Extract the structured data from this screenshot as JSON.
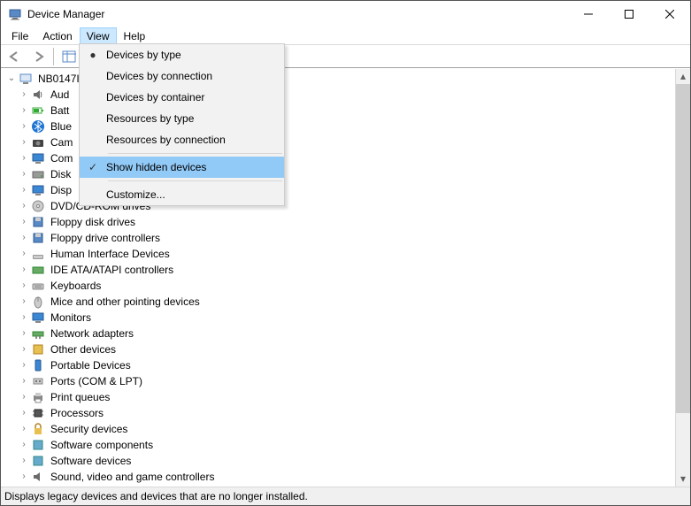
{
  "window": {
    "title": "Device Manager"
  },
  "menubar": {
    "file": "File",
    "action": "Action",
    "view": "View",
    "help": "Help"
  },
  "view_menu": {
    "devices_by_type": "Devices by type",
    "devices_by_connection": "Devices by connection",
    "devices_by_container": "Devices by container",
    "resources_by_type": "Resources by type",
    "resources_by_connection": "Resources by connection",
    "show_hidden": "Show hidden devices",
    "customize": "Customize..."
  },
  "tree": {
    "root": "NB0147I",
    "items": [
      "Aud",
      "Batt",
      "Blue",
      "Cam",
      "Com",
      "Disk",
      "Disp",
      "DVD/CD-ROM drives",
      "Floppy disk drives",
      "Floppy drive controllers",
      "Human Interface Devices",
      "IDE ATA/ATAPI controllers",
      "Keyboards",
      "Mice and other pointing devices",
      "Monitors",
      "Network adapters",
      "Other devices",
      "Portable Devices",
      "Ports (COM & LPT)",
      "Print queues",
      "Processors",
      "Security devices",
      "Software components",
      "Software devices",
      "Sound, video and game controllers"
    ]
  },
  "statusbar": {
    "text": "Displays legacy devices and devices that are no longer installed."
  }
}
